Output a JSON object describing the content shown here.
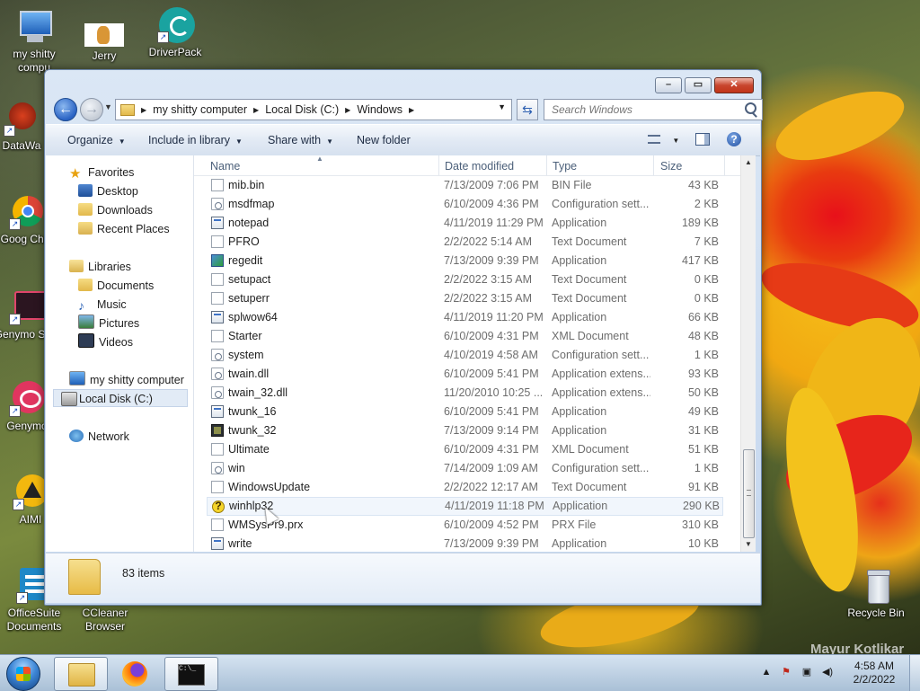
{
  "desktop": {
    "watermark": "Mayur Kotlikar",
    "icons": [
      {
        "label": "my shitty compu"
      },
      {
        "label": "Jerry"
      },
      {
        "label": "DriverPack"
      },
      {
        "label": "DataWa"
      },
      {
        "label": "Goog Chro"
      },
      {
        "label": "Genymo Shel"
      },
      {
        "label": "Genymo"
      },
      {
        "label": "AIMI"
      },
      {
        "label": "OfficeSuite Documents"
      },
      {
        "label": "CCleaner Browser"
      },
      {
        "label": "Recycle Bin"
      }
    ]
  },
  "window": {
    "address": {
      "crumbs": [
        "my shitty computer",
        "Local Disk (C:)",
        "Windows"
      ]
    },
    "search": {
      "placeholder": "Search Windows"
    },
    "toolbar": {
      "organize": "Organize",
      "include_in_library": "Include in library",
      "share_with": "Share with",
      "new_folder": "New folder"
    },
    "nav": {
      "favorites": "Favorites",
      "desktop": "Desktop",
      "downloads": "Downloads",
      "recent_places": "Recent Places",
      "libraries": "Libraries",
      "documents": "Documents",
      "music": "Music",
      "pictures": "Pictures",
      "videos": "Videos",
      "computer": "my shitty computer",
      "local_disk": "Local Disk (C:)",
      "network": "Network"
    },
    "columns": {
      "name": "Name",
      "date": "Date modified",
      "type": "Type",
      "size": "Size"
    },
    "files": [
      {
        "name": "mib.bin",
        "date": "7/13/2009 7:06 PM",
        "type": "BIN File",
        "size": "43 KB",
        "icon": "doc"
      },
      {
        "name": "msdfmap",
        "date": "6/10/2009 4:36 PM",
        "type": "Configuration sett...",
        "size": "2 KB",
        "icon": "cfg"
      },
      {
        "name": "notepad",
        "date": "4/11/2019 11:29 PM",
        "type": "Application",
        "size": "189 KB",
        "icon": "app"
      },
      {
        "name": "PFRO",
        "date": "2/2/2022 5:14 AM",
        "type": "Text Document",
        "size": "7 KB",
        "icon": "doc"
      },
      {
        "name": "regedit",
        "date": "7/13/2009 9:39 PM",
        "type": "Application",
        "size": "417 KB",
        "icon": "reg"
      },
      {
        "name": "setupact",
        "date": "2/2/2022 3:15 AM",
        "type": "Text Document",
        "size": "0 KB",
        "icon": "doc"
      },
      {
        "name": "setuperr",
        "date": "2/2/2022 3:15 AM",
        "type": "Text Document",
        "size": "0 KB",
        "icon": "doc"
      },
      {
        "name": "splwow64",
        "date": "4/11/2019 11:20 PM",
        "type": "Application",
        "size": "66 KB",
        "icon": "app"
      },
      {
        "name": "Starter",
        "date": "6/10/2009 4:31 PM",
        "type": "XML Document",
        "size": "48 KB",
        "icon": "doc"
      },
      {
        "name": "system",
        "date": "4/10/2019 4:58 AM",
        "type": "Configuration sett...",
        "size": "1 KB",
        "icon": "cfg"
      },
      {
        "name": "twain.dll",
        "date": "6/10/2009 5:41 PM",
        "type": "Application extens...",
        "size": "93 KB",
        "icon": "cfg"
      },
      {
        "name": "twain_32.dll",
        "date": "11/20/2010 10:25 ...",
        "type": "Application extens...",
        "size": "50 KB",
        "icon": "cfg"
      },
      {
        "name": "twunk_16",
        "date": "6/10/2009 5:41 PM",
        "type": "Application",
        "size": "49 KB",
        "icon": "app"
      },
      {
        "name": "twunk_32",
        "date": "7/13/2009 9:14 PM",
        "type": "Application",
        "size": "31 KB",
        "icon": "dos"
      },
      {
        "name": "Ultimate",
        "date": "6/10/2009 4:31 PM",
        "type": "XML Document",
        "size": "51 KB",
        "icon": "doc"
      },
      {
        "name": "win",
        "date": "7/14/2009 1:09 AM",
        "type": "Configuration sett...",
        "size": "1 KB",
        "icon": "cfg"
      },
      {
        "name": "WindowsUpdate",
        "date": "2/2/2022 12:17 AM",
        "type": "Text Document",
        "size": "91 KB",
        "icon": "doc"
      },
      {
        "name": "winhlp32",
        "date": "4/11/2019 11:18 PM",
        "type": "Application",
        "size": "290 KB",
        "icon": "help"
      },
      {
        "name": "WMSysPr9.prx",
        "date": "6/10/2009 4:52 PM",
        "type": "PRX File",
        "size": "310 KB",
        "icon": "doc"
      },
      {
        "name": "write",
        "date": "7/13/2009 9:39 PM",
        "type": "Application",
        "size": "10 KB",
        "icon": "app"
      }
    ],
    "status": {
      "item_count": "83 items"
    }
  },
  "taskbar": {
    "clock_time": "4:58 AM",
    "clock_date": "2/2/2022"
  }
}
